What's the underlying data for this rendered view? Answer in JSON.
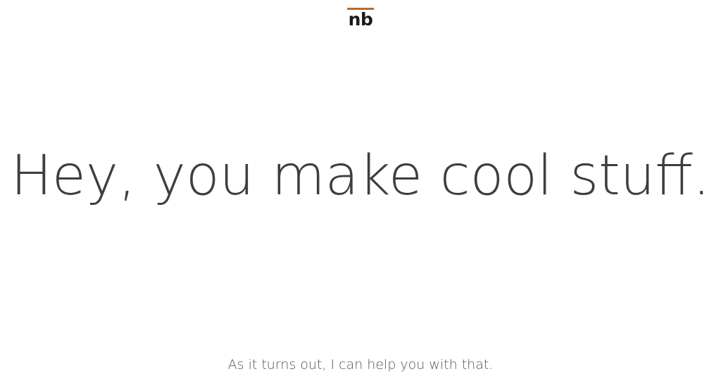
{
  "header": {
    "logo_text": "nb",
    "logo_accent_color": "#c0682e"
  },
  "hero": {
    "headline": "Hey, you make cool stuff.",
    "subline": "As it turns out, I can help you with that."
  }
}
